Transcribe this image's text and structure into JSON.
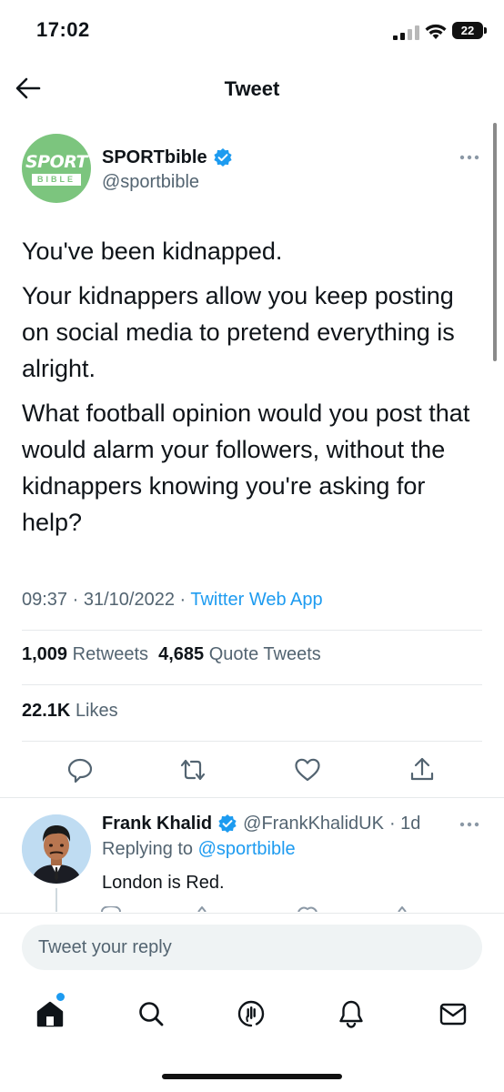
{
  "status_bar": {
    "time": "17:02",
    "battery": "22"
  },
  "header": {
    "title": "Tweet"
  },
  "tweet": {
    "author": {
      "name": "SPORTbible",
      "handle": "@sportbible",
      "avatar_logo_top": "SPORT",
      "avatar_logo_bottom": "BIBLE"
    },
    "paragraphs": [
      "You've been kidnapped.",
      "Your kidnappers allow you keep posting on social media to pretend everything is alright.",
      "What football opinion would you post that would alarm your followers, without the kidnappers knowing you're asking for help?"
    ],
    "time": "09:37",
    "date": "31/10/2022",
    "source": "Twitter Web App",
    "separator": " · ",
    "retweets_count": "1,009",
    "retweets_label": "Retweets",
    "quotes_count": "4,685",
    "quotes_label": "Quote Tweets",
    "likes_count": "22.1K",
    "likes_label": "Likes"
  },
  "reply": {
    "name": "Frank Khalid",
    "handle": "@FrankKhalidUK",
    "age": "· 1d",
    "replying_label": "Replying to",
    "replying_to": "@sportbible",
    "text": "London is Red."
  },
  "compose": {
    "placeholder": "Tweet your reply"
  },
  "colors": {
    "accent": "#1d9bf0",
    "secondary_text": "#536471",
    "sportbible_green": "#7cc57e"
  },
  "tab_bar": {
    "items": [
      "home-icon",
      "search-icon",
      "spaces-icon",
      "notifications-icon",
      "messages-icon"
    ],
    "home_has_notification_dot": true
  }
}
